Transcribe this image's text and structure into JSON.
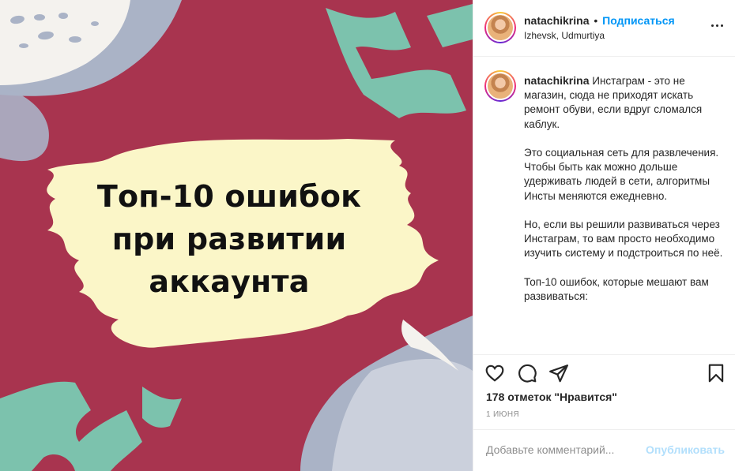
{
  "post": {
    "headline": [
      "Топ-10 ошибок",
      "при развитии",
      "аккаунта"
    ]
  },
  "header": {
    "username": "natachikrina",
    "separator": "•",
    "follow_label": "Подписаться",
    "location": "Izhevsk, Udmurtiya",
    "avatar_icon": "avatar-icon",
    "more_icon": "more-options-icon"
  },
  "caption": {
    "username": "natachikrina",
    "paragraphs": [
      "Инстаграм - это не магазин, сюда не приходят искать ремонт обуви, если вдруг сломался каблук.",
      "Это социальная сеть для развлечения.\nЧтобы быть как можно дольше удерживать людей в сети, алгоритмы Инсты меняются ежедневно.",
      "Но, если вы решили развиваться через Инстаграм, то вам просто необходимо изучить систему и подстроиться по неё.",
      "Топ-10 ошибок, которые мешают вам развиваться:"
    ]
  },
  "actions": {
    "icons": [
      "heart-icon",
      "comment-icon",
      "share-icon",
      "bookmark-icon"
    ],
    "likes": "178 отметок \"Нравится\"",
    "date": "1 ИЮНЯ"
  },
  "comment": {
    "placeholder": "Добавьте комментарий...",
    "publish_label": "Опубликовать"
  },
  "colors": {
    "background_image": "#a8344f",
    "accent_mint": "#7cc2ad",
    "accent_gray": "#aab3c6",
    "highlight": "#fbf6c8",
    "link_blue": "#0095f6"
  }
}
